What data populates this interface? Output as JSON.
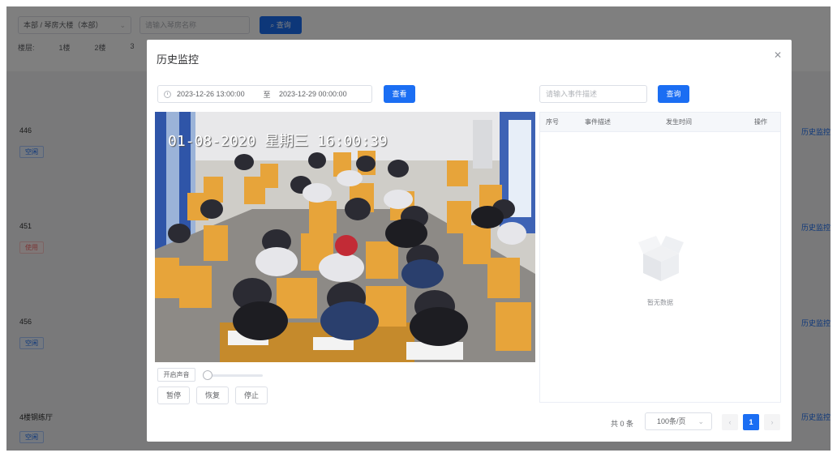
{
  "background": {
    "campus_select": "本部 / 琴房大楼（本部）",
    "room_search_placeholder": "请输入琴房名称",
    "query_label": "查询",
    "floor_label": "楼层:",
    "floors": [
      "1楼",
      "2楼",
      "3"
    ],
    "rooms": [
      {
        "name": "446",
        "status": "空闲"
      },
      {
        "name": "451",
        "status": "使用"
      },
      {
        "name": "456",
        "status": "空闲"
      },
      {
        "name": "4楼钢练厅",
        "status": "空闲"
      }
    ],
    "history_link": "历史监控"
  },
  "modal": {
    "title": "历史监控",
    "start_time": "2023-12-26 13:00:00",
    "range_separator": "至",
    "end_time": "2023-12-29 00:00:00",
    "view_button": "查看",
    "event_search_placeholder": "请输入事件描述",
    "event_query_button": "查询",
    "video": {
      "osd_text": "01-08-2020  星期三  16:00:39"
    },
    "sound_button": "开启声音",
    "volume_level": 0,
    "buttons": {
      "pause": "暂停",
      "resume": "恢复",
      "stop": "停止"
    },
    "table": {
      "columns": [
        "序号",
        "事件描述",
        "发生时间",
        "操作"
      ],
      "empty_text": "暂无数据"
    },
    "pagination": {
      "total": "共 0 条",
      "page_size": "100条/页",
      "prev": "‹",
      "current": "1",
      "next": "›"
    }
  }
}
